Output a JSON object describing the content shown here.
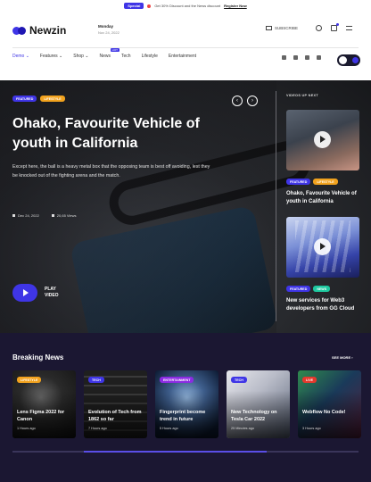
{
  "promo": {
    "badge": "Special",
    "text": "Get 30% Discount and the News discount",
    "link": "Register Now"
  },
  "header": {
    "logo": "Newzin",
    "day": "Monday",
    "date": "Nov 24, 2022",
    "subscribe": "SUBSCRIBE"
  },
  "nav": {
    "items": [
      {
        "label": "Demo ⌄"
      },
      {
        "label": "Features ⌄"
      },
      {
        "label": "Shop ⌄"
      },
      {
        "label": "News",
        "badge": "HOT"
      },
      {
        "label": "Tech"
      },
      {
        "label": "Lifestyle"
      },
      {
        "label": "Entertainment"
      }
    ]
  },
  "hero": {
    "tags": [
      "FEATURED",
      "LIFESTYLE"
    ],
    "title": "Ohako, Favourite Vehicle of youth in California",
    "excerpt": "Except here, the ball is a heavy metal box that the opposing team is best off avoiding, lest they be knocked out of the fighting arena and the match.",
    "date": "Dec 24, 2022",
    "views": "20,65 Views",
    "play_label_1": "PLAY",
    "play_label_2": "VIDEO",
    "prev_arrow": "‹",
    "next_arrow": "›"
  },
  "side": {
    "title": "VIDEOS UP NEXT",
    "cards": [
      {
        "tags": [
          "FEATURED",
          "LIFESTYLE"
        ],
        "caption": "Ohako, Favourite Vehicle of youth in California"
      },
      {
        "tags": [
          "FEATURED",
          "NEWS"
        ],
        "caption": "New services for Web3 developers from GG Cloud"
      }
    ]
  },
  "breaking": {
    "title": "Breaking News",
    "more": "SEE MORE ›",
    "cards": [
      {
        "tag": "LIFESTYLE",
        "caption": "Lens Figma 2022 for Canon",
        "meta": "1 Hours ago"
      },
      {
        "tag": "TECH",
        "caption": "Evolution of Tech from 1862 so far",
        "meta": "7 Hours ago"
      },
      {
        "tag": "ENTERTAINMENT",
        "caption": "Fingerprint become trend in future",
        "meta": "5 Hours ago"
      },
      {
        "tag": "TECH",
        "caption": "New Technology on Tesla Car 2022",
        "meta": "25 Minutes ago"
      },
      {
        "tag": "LIVE",
        "caption": "Webflow No Code!",
        "meta": "3 Hours ago"
      }
    ]
  },
  "colors": {
    "accent": "#3f35e6",
    "breaking_bg": "#1b1732"
  }
}
